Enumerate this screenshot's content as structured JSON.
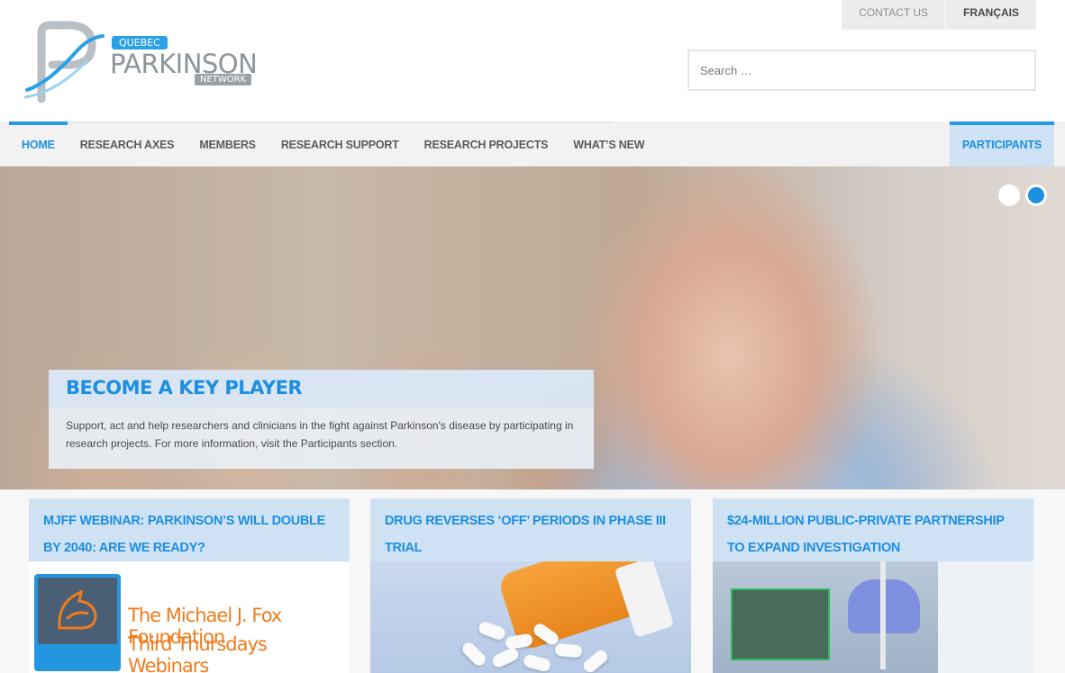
{
  "header": {
    "logo": {
      "badge_top": "QUEBEC",
      "word": "PARKINSON",
      "badge_bottom": "NETWORK"
    },
    "topbar": {
      "contact": "CONTACT US",
      "language": "FRANÇAIS"
    },
    "search": {
      "placeholder": "Search …"
    }
  },
  "nav": {
    "items": [
      {
        "label": "HOME",
        "active": true
      },
      {
        "label": "RESEARCH AXES"
      },
      {
        "label": "MEMBERS"
      },
      {
        "label": "RESEARCH SUPPORT"
      },
      {
        "label": "RESEARCH PROJECTS"
      },
      {
        "label": "WHAT’S NEW"
      }
    ],
    "participants": "PARTICIPANTS"
  },
  "hero": {
    "title": "BECOME A KEY PLAYER",
    "text": "Support, act and help researchers and clinicians in the fight against Parkinson's disease by participating in research projects. For more information, visit the Participants section.",
    "slides": 2,
    "active_slide": 2
  },
  "cards": [
    {
      "title": "MJFF WEBINAR: PARKINSON’S WILL DOUBLE BY 2040: ARE WE READY?",
      "image_line1": "The Michael J. Fox Foundation",
      "image_line2": "Third Thursdays Webinars"
    },
    {
      "title": "DRUG REVERSES ‘OFF’ PERIODS IN PHASE III TRIAL"
    },
    {
      "title": "$24-MILLION PUBLIC-PRIVATE PARTNERSHIP TO EXPAND INVESTIGATION"
    }
  ],
  "colors": {
    "accent": "#1d8fe1",
    "accent_light": "#cfe2f4",
    "nav_bg": "#f2f2f2",
    "topbar_bg": "#ececec",
    "logo_grey": "#8d9599",
    "mjff_orange": "#f07b1c"
  }
}
